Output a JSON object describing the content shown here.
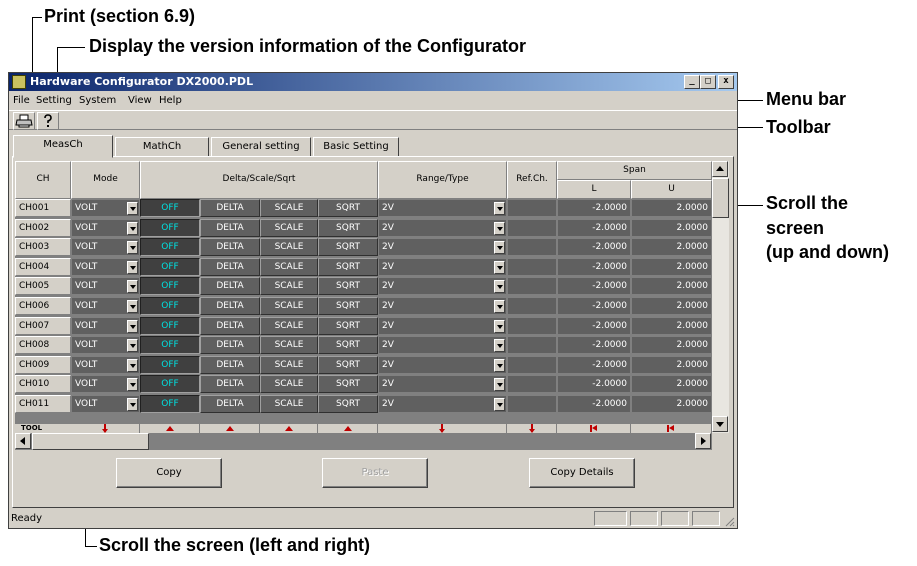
{
  "annotations": {
    "print": "Print (section 6.9)",
    "version": "Display the version information of the Configurator",
    "menubar": "Menu bar",
    "toolbar": "Toolbar",
    "scroll_ud": [
      "Scroll the",
      "screen",
      "(up and down)"
    ],
    "scroll_lr": "Scroll the screen (left and right)"
  },
  "window": {
    "title": "Hardware Configurator DX2000.PDL",
    "controls": [
      "_",
      "□",
      "x"
    ]
  },
  "menu": [
    "File",
    "Setting",
    "System",
    "View",
    "Help"
  ],
  "toolbar": {
    "buttons": [
      "printer-icon",
      "help-icon"
    ]
  },
  "tabs": [
    "MeasCh",
    "MathCh",
    "General setting",
    "Basic Setting"
  ],
  "table": {
    "headers": {
      "ch": "CH",
      "mode": "Mode",
      "delta": "Delta/Scale/Sqrt",
      "range": "Range/Type",
      "ref": "Ref.Ch.",
      "span": "Span",
      "span_l": "L",
      "span_u": "U"
    },
    "rows": [
      {
        "ch": "CH001",
        "mode": "VOLT",
        "off": "OFF",
        "delta": "DELTA",
        "scale": "SCALE",
        "sqrt": "SQRT",
        "range": "2V",
        "ref": "",
        "l": "-2.0000",
        "u": "2.0000"
      },
      {
        "ch": "CH002",
        "mode": "VOLT",
        "off": "OFF",
        "delta": "DELTA",
        "scale": "SCALE",
        "sqrt": "SQRT",
        "range": "2V",
        "ref": "",
        "l": "-2.0000",
        "u": "2.0000"
      },
      {
        "ch": "CH003",
        "mode": "VOLT",
        "off": "OFF",
        "delta": "DELTA",
        "scale": "SCALE",
        "sqrt": "SQRT",
        "range": "2V",
        "ref": "",
        "l": "-2.0000",
        "u": "2.0000"
      },
      {
        "ch": "CH004",
        "mode": "VOLT",
        "off": "OFF",
        "delta": "DELTA",
        "scale": "SCALE",
        "sqrt": "SQRT",
        "range": "2V",
        "ref": "",
        "l": "-2.0000",
        "u": "2.0000"
      },
      {
        "ch": "CH005",
        "mode": "VOLT",
        "off": "OFF",
        "delta": "DELTA",
        "scale": "SCALE",
        "sqrt": "SQRT",
        "range": "2V",
        "ref": "",
        "l": "-2.0000",
        "u": "2.0000"
      },
      {
        "ch": "CH006",
        "mode": "VOLT",
        "off": "OFF",
        "delta": "DELTA",
        "scale": "SCALE",
        "sqrt": "SQRT",
        "range": "2V",
        "ref": "",
        "l": "-2.0000",
        "u": "2.0000"
      },
      {
        "ch": "CH007",
        "mode": "VOLT",
        "off": "OFF",
        "delta": "DELTA",
        "scale": "SCALE",
        "sqrt": "SQRT",
        "range": "2V",
        "ref": "",
        "l": "-2.0000",
        "u": "2.0000"
      },
      {
        "ch": "CH008",
        "mode": "VOLT",
        "off": "OFF",
        "delta": "DELTA",
        "scale": "SCALE",
        "sqrt": "SQRT",
        "range": "2V",
        "ref": "",
        "l": "-2.0000",
        "u": "2.0000"
      },
      {
        "ch": "CH009",
        "mode": "VOLT",
        "off": "OFF",
        "delta": "DELTA",
        "scale": "SCALE",
        "sqrt": "SQRT",
        "range": "2V",
        "ref": "",
        "l": "-2.0000",
        "u": "2.0000"
      },
      {
        "ch": "CH010",
        "mode": "VOLT",
        "off": "OFF",
        "delta": "DELTA",
        "scale": "SCALE",
        "sqrt": "SQRT",
        "range": "2V",
        "ref": "",
        "l": "-2.0000",
        "u": "2.0000"
      },
      {
        "ch": "CH011",
        "mode": "VOLT",
        "off": "OFF",
        "delta": "DELTA",
        "scale": "SCALE",
        "sqrt": "SQRT",
        "range": "2V",
        "ref": "",
        "l": "-2.0000",
        "u": "2.0000"
      }
    ],
    "tool_label": "TOOL"
  },
  "buttons": {
    "copy": "Copy",
    "paste": "Paste",
    "copy_details": "Copy Details"
  },
  "status": "Ready",
  "colors": {
    "off_text": "#00e0e0",
    "marker": "#c00000",
    "title_start": "#0a246a"
  }
}
